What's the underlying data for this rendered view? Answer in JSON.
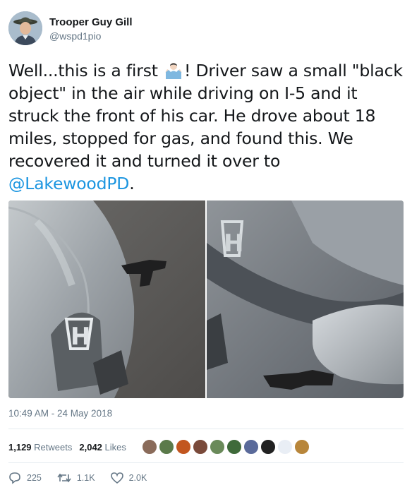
{
  "user": {
    "display_name": "Trooper Guy Gill",
    "handle": "@wspd1pio"
  },
  "tweet": {
    "text_before_emoji": "Well...this is a first ",
    "emoji": "man-shrugging-icon",
    "text_after_emoji": "!  Driver saw a small \"black object\" in the air while driving on I-5 and it struck the front of his car.  He drove about 18 miles, stopped for gas, and found this.  We recovered it and turned it over to ",
    "mention": "@LakewoodPD",
    "text_end": "."
  },
  "timestamp": "10:49 AM - 24 May 2018",
  "stats": {
    "retweets_count": "1,129",
    "retweets_label": "Retweets",
    "likes_count": "2,042",
    "likes_label": "Likes"
  },
  "likers_colors": [
    "#8a6b5a",
    "#5b7a4a",
    "#c2561f",
    "#7a4a3a",
    "#6a8a5a",
    "#3f6a3a",
    "#5a6a9a",
    "#222222",
    "#e9eef5",
    "#b8863b"
  ],
  "actions": {
    "reply_count": "225",
    "retweet_count": "1.1K",
    "like_count": "2.0K"
  }
}
